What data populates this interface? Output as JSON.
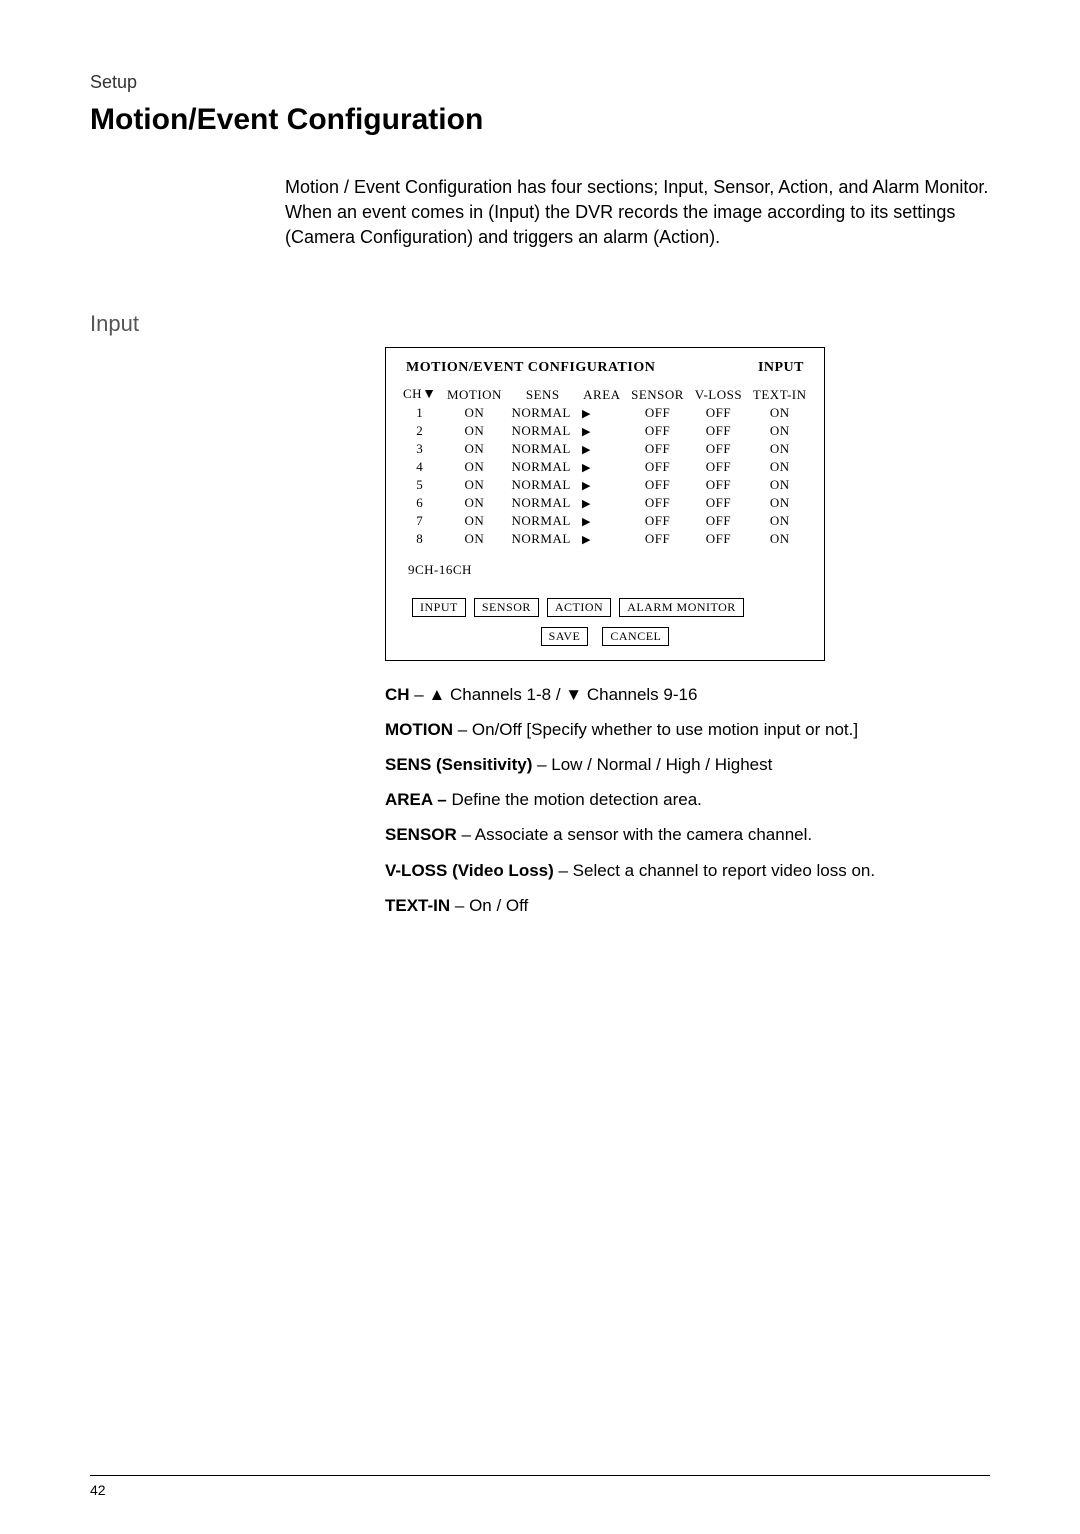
{
  "section_label": "Setup",
  "heading": "Motion/Event Configuration",
  "intro": "Motion / Event Configuration has four sections; Input, Sensor, Action, and Alarm Monitor. When an event comes in (Input) the DVR records the image according to its settings (Camera Configuration) and triggers an alarm (Action).",
  "sub_heading": "Input",
  "config": {
    "title_left": "MOTION/EVENT CONFIGURATION",
    "title_right": "INPUT",
    "headers": [
      "CH",
      "MOTION",
      "SENS",
      "AREA",
      "SENSOR",
      "V-LOSS",
      "TEXT-IN"
    ],
    "ch_header_arrow": "▼",
    "rows": [
      {
        "ch": "1",
        "motion": "ON",
        "sens": "NORMAL",
        "sensor": "OFF",
        "vloss": "OFF",
        "textin": "ON"
      },
      {
        "ch": "2",
        "motion": "ON",
        "sens": "NORMAL",
        "sensor": "OFF",
        "vloss": "OFF",
        "textin": "ON"
      },
      {
        "ch": "3",
        "motion": "ON",
        "sens": "NORMAL",
        "sensor": "OFF",
        "vloss": "OFF",
        "textin": "ON"
      },
      {
        "ch": "4",
        "motion": "ON",
        "sens": "NORMAL",
        "sensor": "OFF",
        "vloss": "OFF",
        "textin": "ON"
      },
      {
        "ch": "5",
        "motion": "ON",
        "sens": "NORMAL",
        "sensor": "OFF",
        "vloss": "OFF",
        "textin": "ON"
      },
      {
        "ch": "6",
        "motion": "ON",
        "sens": "NORMAL",
        "sensor": "OFF",
        "vloss": "OFF",
        "textin": "ON"
      },
      {
        "ch": "7",
        "motion": "ON",
        "sens": "NORMAL",
        "sensor": "OFF",
        "vloss": "OFF",
        "textin": "ON"
      },
      {
        "ch": "8",
        "motion": "ON",
        "sens": "NORMAL",
        "sensor": "OFF",
        "vloss": "OFF",
        "textin": "ON"
      }
    ],
    "area_arrow": "▶",
    "ch_range": "9CH-16CH",
    "tabs": [
      "INPUT",
      "SENSOR",
      "ACTION",
      "ALARM MONITOR"
    ],
    "buttons": [
      "SAVE",
      "CANCEL"
    ]
  },
  "defs": [
    {
      "label": "CH",
      "text": " – ▲ Channels 1-8 / ▼ Channels 9-16"
    },
    {
      "label": "MOTION",
      "text": " – On/Off [Specify whether to use motion input or not.]"
    },
    {
      "label": "SENS (Sensitivity)",
      "text": " – Low / Normal / High / Highest"
    },
    {
      "label": "AREA –",
      "text": " Define the motion detection area."
    },
    {
      "label": "SENSOR",
      "text": " – Associate a sensor with the camera channel."
    },
    {
      "label": "V-LOSS (Video Loss)",
      "text": " – Select a channel to report video loss on."
    },
    {
      "label": "TEXT-IN",
      "text": " – On / Off"
    }
  ],
  "page_number": "42"
}
